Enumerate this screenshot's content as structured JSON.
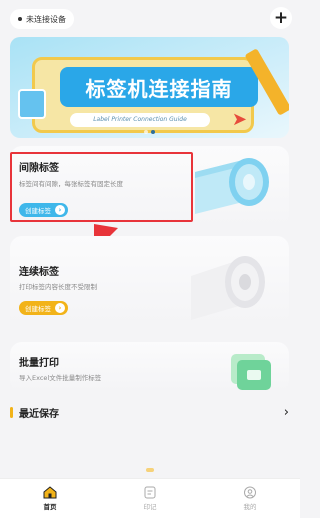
{
  "header": {
    "device_status": "未连接设备",
    "add_icon": "plus-icon"
  },
  "banner": {
    "title": "标签机连接指南",
    "subtitle": "Label Printer Connection Guide",
    "page_count": 2,
    "active_page": 2
  },
  "cards": [
    {
      "title": "间隙标签",
      "desc": "标签间有间隙，每张标签有固定长度",
      "button": "创建标签",
      "accent": "#3fb7ea"
    },
    {
      "title": "连续标签",
      "desc": "打印标签内容长度不受限制",
      "button": "创建标签",
      "accent": "#f2b319"
    },
    {
      "title": "批量打印",
      "desc": "导入Excel文件批量制作标签"
    }
  ],
  "recent": {
    "title": "最近保存"
  },
  "tabs": [
    {
      "label": "首页",
      "icon": "home-icon",
      "active": true
    },
    {
      "label": "印记",
      "icon": "record-icon",
      "active": false
    },
    {
      "label": "我的",
      "icon": "profile-icon",
      "active": false
    }
  ],
  "colors": {
    "highlight": "#e8343a",
    "annotation_arrow": "#e8343a",
    "accent_yellow": "#f2b319",
    "accent_blue": "#3fb7ea"
  }
}
